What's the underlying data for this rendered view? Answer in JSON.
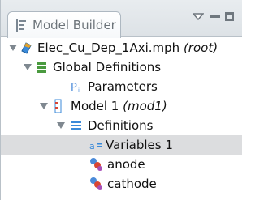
{
  "window": {
    "title": "Model Builder"
  },
  "tree": {
    "root": {
      "label": "Elec_Cu_Dep_1Axi.mph",
      "suffix": "(root)"
    },
    "global_definitions": {
      "label": "Global Definitions"
    },
    "parameters": {
      "label": "Parameters"
    },
    "model": {
      "label": "Model 1",
      "suffix": "(mod1)"
    },
    "definitions": {
      "label": "Definitions"
    },
    "variables": {
      "label": "Variables 1"
    },
    "anode": {
      "label": "anode"
    },
    "cathode": {
      "label": "cathode"
    }
  },
  "colors": {
    "header_background": "#e8ecef",
    "selection_background": "#dcdddf",
    "expand_arrow": "#7f8890",
    "global_icon": "#4a9a3f",
    "model_icon": "#3b8ad9",
    "parameters_icon": "#4a8ad9"
  },
  "icons": {
    "window": "model-builder-icon",
    "root": "model-file-icon",
    "global_definitions": "global-definitions-icon",
    "parameters": "parameters-icon",
    "model": "model-component-icon",
    "definitions": "definitions-list-icon",
    "variables": "variables-icon",
    "anode": "selection-icon",
    "cathode": "selection-icon"
  }
}
